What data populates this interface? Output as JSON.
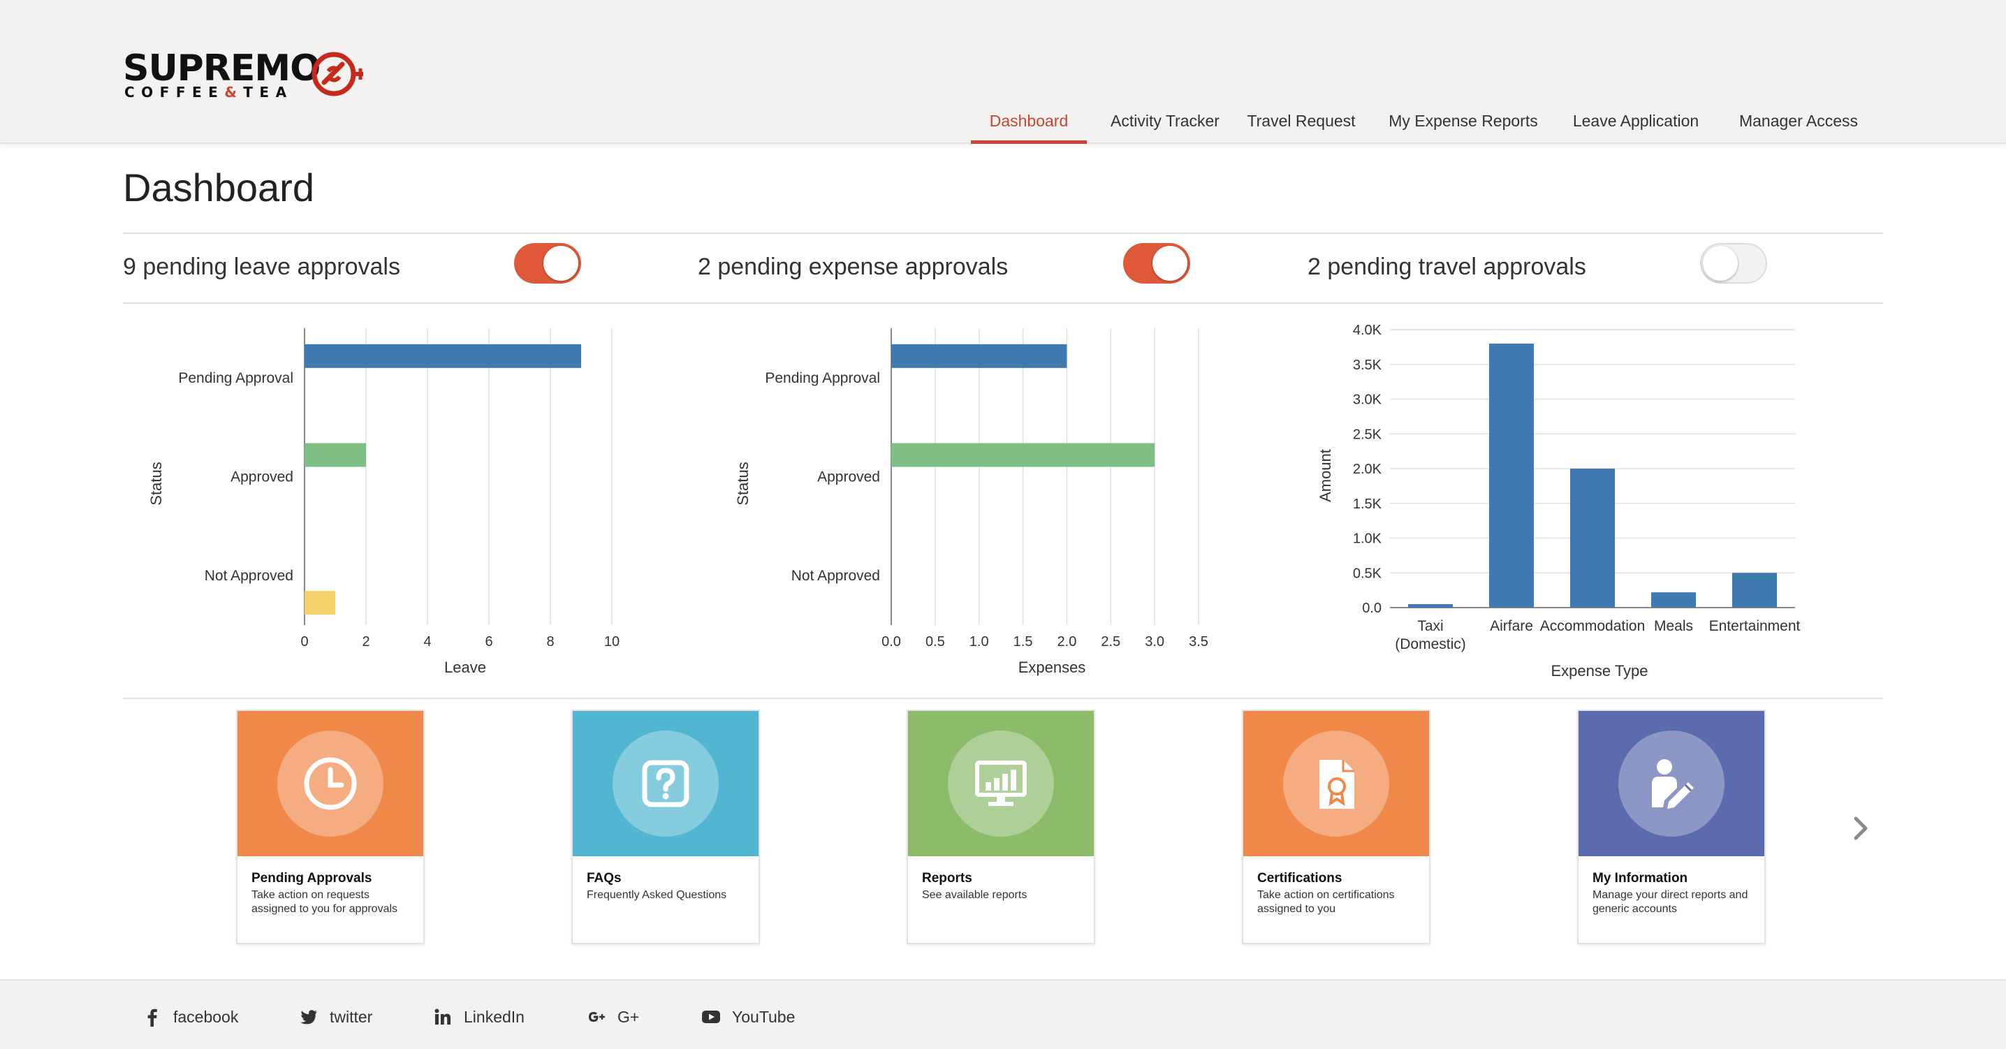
{
  "brand": {
    "name": "SUPREMO",
    "tagline_left": "COFFEE",
    "tagline_amp": "&",
    "tagline_right": "TEA",
    "accent_color": "#c74634"
  },
  "nav": {
    "items": [
      {
        "label": "Dashboard",
        "active": true
      },
      {
        "label": "Activity Tracker",
        "active": false
      },
      {
        "label": "Travel Request",
        "active": false
      },
      {
        "label": "My Expense Reports",
        "active": false
      },
      {
        "label": "Leave Application",
        "active": false
      },
      {
        "label": "Manager Access",
        "active": false
      }
    ]
  },
  "page": {
    "title": "Dashboard"
  },
  "approvals": [
    {
      "label": "9 pending leave approvals",
      "enabled": true
    },
    {
      "label": "2 pending expense approvals",
      "enabled": true
    },
    {
      "label": "2 pending travel approvals",
      "enabled": false
    }
  ],
  "chart_data": [
    {
      "type": "bar",
      "orientation": "horizontal",
      "categories": [
        "Pending Approval",
        "Approved",
        "Not Approved"
      ],
      "values": [
        9,
        2,
        1
      ],
      "colors": [
        "#3f7bb0",
        "#7fbf86",
        "#f3d26b"
      ],
      "xlabel": "Leave",
      "ylabel": "Status",
      "xlim": [
        0,
        10
      ],
      "xticks": [
        "0",
        "2",
        "4",
        "6",
        "8",
        "10"
      ],
      "grid": true
    },
    {
      "type": "bar",
      "orientation": "horizontal",
      "categories": [
        "Pending Approval",
        "Approved",
        "Not Approved"
      ],
      "values": [
        2,
        3,
        0
      ],
      "colors": [
        "#3f7bb0",
        "#7fbf86",
        "#f3d26b"
      ],
      "xlabel": "Expenses",
      "ylabel": "Status",
      "xlim": [
        0,
        3.5
      ],
      "xticks": [
        "0.0",
        "0.5",
        "1.0",
        "1.5",
        "2.0",
        "2.5",
        "3.0",
        "3.5"
      ],
      "grid": true
    },
    {
      "type": "bar",
      "orientation": "vertical",
      "categories": [
        "Taxi (Domestic)",
        "Airfare",
        "Accommodation",
        "Meals",
        "Entertainment"
      ],
      "category_lines": [
        [
          "Taxi",
          "(Domestic)"
        ],
        [
          "Airfare"
        ],
        [
          "Accommodation"
        ],
        [
          "Meals"
        ],
        [
          "Entertainment"
        ]
      ],
      "values": [
        50,
        3800,
        2000,
        220,
        500
      ],
      "colors": [
        "#3f7bb0"
      ],
      "xlabel": "Expense Type",
      "ylabel": "Amount",
      "ylim": [
        0,
        4000
      ],
      "yticks": [
        "0.0",
        "0.5K",
        "1.0K",
        "1.5K",
        "2.0K",
        "2.5K",
        "3.0K",
        "3.5K",
        "4.0K"
      ],
      "grid": true
    }
  ],
  "tiles": [
    {
      "title": "Pending Approvals",
      "description": "Take action on requests assigned to you for approvals",
      "icon": "clock-icon",
      "color": "#f0884a"
    },
    {
      "title": "FAQs",
      "description": "Frequently Asked Questions",
      "icon": "question-icon",
      "color": "#52b6d2"
    },
    {
      "title": "Reports",
      "description": "See available reports",
      "icon": "monitor-chart-icon",
      "color": "#8cbb6a"
    },
    {
      "title": "Certifications",
      "description": "Take action on certifications assigned to you",
      "icon": "certificate-icon",
      "color": "#f0884a"
    },
    {
      "title": "My Information",
      "description": "Manage your direct reports and generic accounts",
      "icon": "user-edit-icon",
      "color": "#5c6aae"
    }
  ],
  "footer": {
    "links": [
      {
        "label": "facebook",
        "icon": "facebook-icon"
      },
      {
        "label": "twitter",
        "icon": "twitter-icon"
      },
      {
        "label": "LinkedIn",
        "icon": "linkedin-icon"
      },
      {
        "label": "G+",
        "icon": "google-plus-icon"
      },
      {
        "label": "YouTube",
        "icon": "youtube-icon"
      }
    ]
  }
}
